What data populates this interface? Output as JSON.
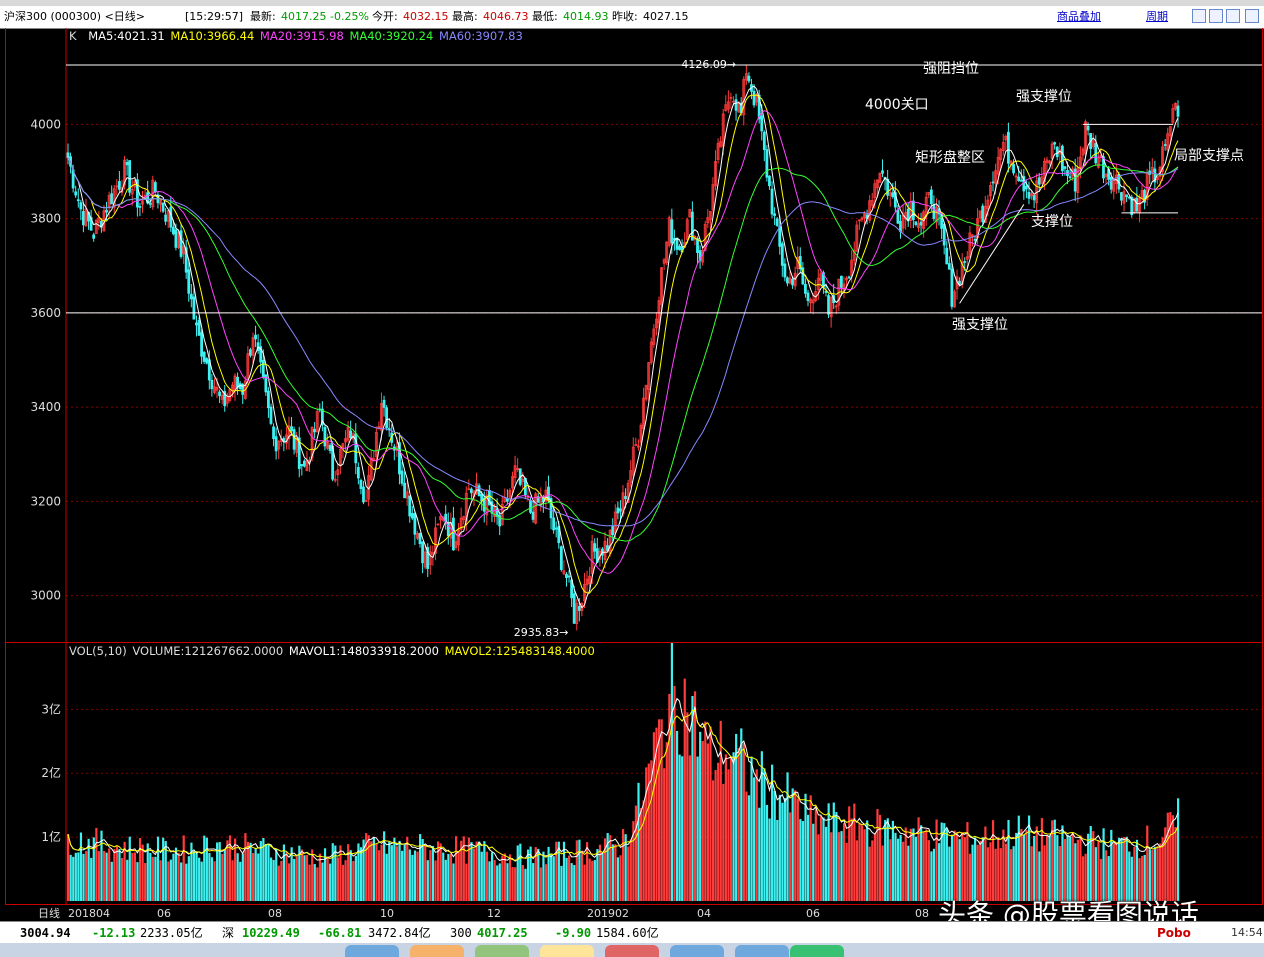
{
  "header": {
    "title": "沪深300 (000300) <日线>",
    "time": "[15:29:57]",
    "latest_label": "最新:",
    "latest_value": "4017.25",
    "change_pct": "-0.25%",
    "open_label": "今开:",
    "open_value": "4032.15",
    "high_label": "最高:",
    "high_value": "4046.73",
    "low_label": "最低:",
    "low_value": "4014.93",
    "prev_label": "昨收:",
    "prev_value": "4027.15",
    "overlay_link": "商品叠加",
    "period_link": "周期"
  },
  "ma_legend": {
    "k": "K",
    "ma5": "MA5:4021.31",
    "ma10": "MA10:3966.44",
    "ma20": "MA20:3915.98",
    "ma40": "MA40:3920.24",
    "ma60": "MA60:3907.83"
  },
  "vol_legend": {
    "vol": "VOL(5,10)",
    "volume": "VOLUME:121267662.0000",
    "mavol1": "MAVOL1:148033918.2000",
    "mavol2": "MAVOL2:125483148.4000"
  },
  "colors": {
    "up": "#ff3b3b",
    "down": "#3ef0f0",
    "ma5": "#ffffff",
    "ma10": "#ffff00",
    "ma20": "#ff44ff",
    "ma40": "#33ff33",
    "ma60": "#8888ff",
    "grid": "#8b0000"
  },
  "chart_data": {
    "type": "candlestick",
    "y_ticks": [
      "4000",
      "3800",
      "3600",
      "3400",
      "3200",
      "3000"
    ],
    "ylim": [
      2910,
      4145
    ],
    "x_ticks": [
      "日线",
      "201804",
      "06",
      "08",
      "10",
      "12",
      "201902",
      "04",
      "06",
      "08"
    ],
    "close_series": [
      {
        "t": 0,
        "v": 3930
      },
      {
        "t": 5,
        "v": 3820
      },
      {
        "t": 10,
        "v": 3770
      },
      {
        "t": 16,
        "v": 3840
      },
      {
        "t": 22,
        "v": 3900
      },
      {
        "t": 28,
        "v": 3830
      },
      {
        "t": 34,
        "v": 3860
      },
      {
        "t": 40,
        "v": 3790
      },
      {
        "t": 45,
        "v": 3720
      },
      {
        "t": 50,
        "v": 3560
      },
      {
        "t": 55,
        "v": 3480
      },
      {
        "t": 60,
        "v": 3400
      },
      {
        "t": 64,
        "v": 3450
      },
      {
        "t": 68,
        "v": 3440
      },
      {
        "t": 72,
        "v": 3560
      },
      {
        "t": 76,
        "v": 3440
      },
      {
        "t": 80,
        "v": 3330
      },
      {
        "t": 86,
        "v": 3350
      },
      {
        "t": 92,
        "v": 3270
      },
      {
        "t": 98,
        "v": 3390
      },
      {
        "t": 103,
        "v": 3260
      },
      {
        "t": 110,
        "v": 3350
      },
      {
        "t": 116,
        "v": 3200
      },
      {
        "t": 122,
        "v": 3420
      },
      {
        "t": 128,
        "v": 3300
      },
      {
        "t": 134,
        "v": 3170
      },
      {
        "t": 140,
        "v": 3060
      },
      {
        "t": 146,
        "v": 3180
      },
      {
        "t": 150,
        "v": 3120
      },
      {
        "t": 156,
        "v": 3230
      },
      {
        "t": 162,
        "v": 3200
      },
      {
        "t": 168,
        "v": 3150
      },
      {
        "t": 174,
        "v": 3260
      },
      {
        "t": 180,
        "v": 3180
      },
      {
        "t": 186,
        "v": 3210
      },
      {
        "t": 190,
        "v": 3120
      },
      {
        "t": 194,
        "v": 3040
      },
      {
        "t": 197,
        "v": 2960
      },
      {
        "t": 200,
        "v": 3000
      },
      {
        "t": 204,
        "v": 3090
      },
      {
        "t": 210,
        "v": 3110
      },
      {
        "t": 216,
        "v": 3200
      },
      {
        "t": 222,
        "v": 3340
      },
      {
        "t": 226,
        "v": 3500
      },
      {
        "t": 230,
        "v": 3650
      },
      {
        "t": 234,
        "v": 3780
      },
      {
        "t": 238,
        "v": 3740
      },
      {
        "t": 242,
        "v": 3800
      },
      {
        "t": 246,
        "v": 3720
      },
      {
        "t": 250,
        "v": 3830
      },
      {
        "t": 254,
        "v": 3970
      },
      {
        "t": 258,
        "v": 4080
      },
      {
        "t": 262,
        "v": 4020
      },
      {
        "t": 264,
        "v": 4120
      },
      {
        "t": 268,
        "v": 4040
      },
      {
        "t": 272,
        "v": 3900
      },
      {
        "t": 276,
        "v": 3760
      },
      {
        "t": 280,
        "v": 3660
      },
      {
        "t": 284,
        "v": 3700
      },
      {
        "t": 288,
        "v": 3620
      },
      {
        "t": 292,
        "v": 3680
      },
      {
        "t": 296,
        "v": 3600
      },
      {
        "t": 300,
        "v": 3650
      },
      {
        "t": 304,
        "v": 3700
      },
      {
        "t": 308,
        "v": 3780
      },
      {
        "t": 312,
        "v": 3840
      },
      {
        "t": 316,
        "v": 3910
      },
      {
        "t": 320,
        "v": 3850
      },
      {
        "t": 324,
        "v": 3800
      },
      {
        "t": 328,
        "v": 3830
      },
      {
        "t": 332,
        "v": 3790
      },
      {
        "t": 336,
        "v": 3850
      },
      {
        "t": 340,
        "v": 3760
      },
      {
        "t": 344,
        "v": 3640
      },
      {
        "t": 348,
        "v": 3700
      },
      {
        "t": 352,
        "v": 3760
      },
      {
        "t": 356,
        "v": 3820
      },
      {
        "t": 360,
        "v": 3900
      },
      {
        "t": 364,
        "v": 3960
      },
      {
        "t": 368,
        "v": 3920
      },
      {
        "t": 372,
        "v": 3880
      },
      {
        "t": 376,
        "v": 3850
      },
      {
        "t": 380,
        "v": 3900
      },
      {
        "t": 384,
        "v": 3960
      },
      {
        "t": 388,
        "v": 3900
      },
      {
        "t": 392,
        "v": 3880
      },
      {
        "t": 396,
        "v": 3990
      },
      {
        "t": 400,
        "v": 3940
      },
      {
        "t": 404,
        "v": 3900
      },
      {
        "t": 408,
        "v": 3880
      },
      {
        "t": 412,
        "v": 3850
      },
      {
        "t": 416,
        "v": 3820
      },
      {
        "t": 420,
        "v": 3870
      },
      {
        "t": 424,
        "v": 3900
      },
      {
        "t": 428,
        "v": 3960
      },
      {
        "t": 430,
        "v": 4040
      },
      {
        "t": 432,
        "v": 4017
      }
    ],
    "volume_series": [
      {
        "t": 0,
        "v": 1.0
      },
      {
        "t": 20,
        "v": 0.85
      },
      {
        "t": 40,
        "v": 0.8
      },
      {
        "t": 60,
        "v": 0.9
      },
      {
        "t": 80,
        "v": 0.8
      },
      {
        "t": 100,
        "v": 0.7
      },
      {
        "t": 120,
        "v": 0.9
      },
      {
        "t": 140,
        "v": 0.85
      },
      {
        "t": 160,
        "v": 0.8
      },
      {
        "t": 180,
        "v": 0.7
      },
      {
        "t": 200,
        "v": 0.8
      },
      {
        "t": 215,
        "v": 0.9
      },
      {
        "t": 222,
        "v": 1.5
      },
      {
        "t": 230,
        "v": 2.6
      },
      {
        "t": 236,
        "v": 3.4
      },
      {
        "t": 242,
        "v": 3.0
      },
      {
        "t": 250,
        "v": 2.3
      },
      {
        "t": 258,
        "v": 2.4
      },
      {
        "t": 266,
        "v": 2.0
      },
      {
        "t": 274,
        "v": 1.8
      },
      {
        "t": 290,
        "v": 1.3
      },
      {
        "t": 310,
        "v": 1.2
      },
      {
        "t": 330,
        "v": 1.1
      },
      {
        "t": 350,
        "v": 1.0
      },
      {
        "t": 370,
        "v": 1.1
      },
      {
        "t": 390,
        "v": 1.0
      },
      {
        "t": 410,
        "v": 0.9
      },
      {
        "t": 425,
        "v": 1.0
      },
      {
        "t": 432,
        "v": 1.3
      }
    ],
    "vol_y_ticks": [
      "3亿",
      "2亿",
      "1亿"
    ],
    "vol_ylim": [
      0,
      3.6
    ],
    "annotations": [
      {
        "text": "强阻挡位",
        "kind": "label"
      },
      {
        "text": "强支撑位",
        "kind": "label",
        "id": "upper_support"
      },
      {
        "text": "4000关口",
        "kind": "label"
      },
      {
        "text": "矩形盘整区",
        "kind": "label"
      },
      {
        "text": "局部支撑点",
        "kind": "label"
      },
      {
        "text": "支撑位",
        "kind": "label"
      },
      {
        "text": "强支撑位",
        "kind": "label",
        "id": "lower_support"
      },
      {
        "text": "4126.09",
        "kind": "high_marker"
      },
      {
        "text": "2935.83",
        "kind": "low_marker"
      }
    ],
    "horizontal_levels": [
      4126,
      3600
    ]
  },
  "statusbar": {
    "sh_index": "3004.94",
    "sh_change": "-12.13",
    "sh_amount": "2233.05亿",
    "sz_label": "深",
    "sz_index": "10229.49",
    "sz_change": "-66.81",
    "sz_amount": "3472.84亿",
    "hs_label": "300",
    "hs_index": "4017.25",
    "hs_change": "-9.90",
    "hs_amount": "1584.60亿",
    "brand": "Pobo",
    "clock": "14:54"
  },
  "watermark": "头条 @股票看图说话"
}
